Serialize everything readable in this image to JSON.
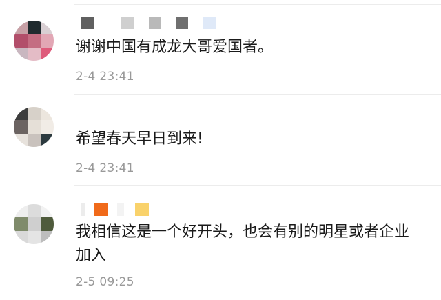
{
  "comments": [
    {
      "text": "谢谢中国有成龙大哥爱国者。",
      "time": "2-4 23:41"
    },
    {
      "text": "希望春天早日到来!",
      "time": "2-4 23:41"
    },
    {
      "text_line1": "我相信这是一个好开头，也会有别的明星或者企业",
      "text_line2": "加入",
      "time": "2-5 09:25"
    }
  ],
  "colors": {
    "text": "#1a1a1a",
    "time": "#999999",
    "divider": "#ececec"
  },
  "icons": {
    "avatar": "user-avatar-pixelated"
  }
}
